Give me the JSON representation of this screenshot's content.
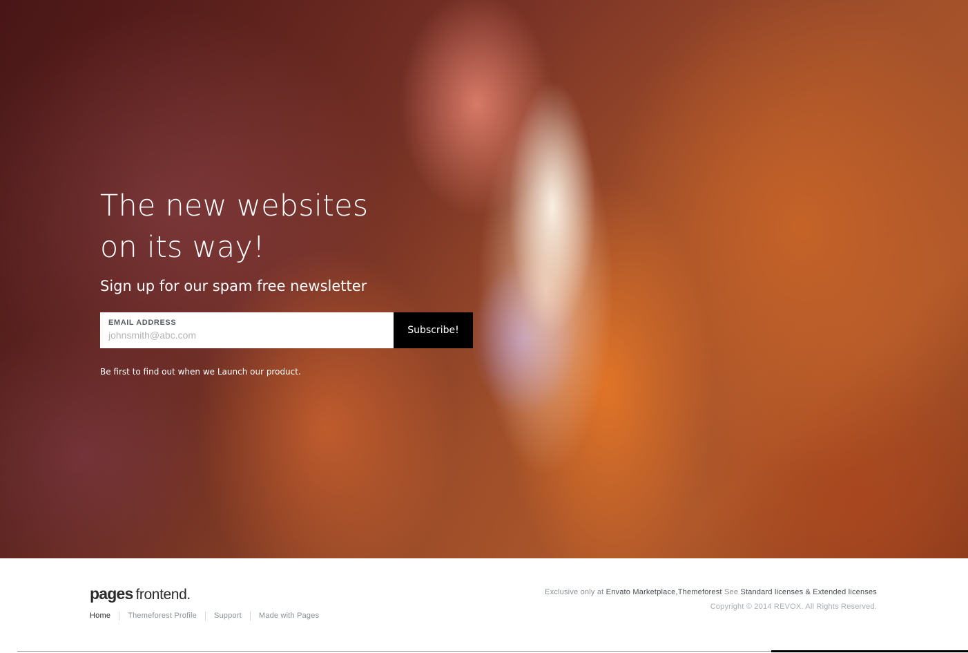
{
  "hero": {
    "headline_line1": "The new websites",
    "headline_line2": "on its way!",
    "subheadline": "Sign up for our spam free newsletter",
    "email_label": "EMAIL ADDRESS",
    "email_placeholder": "johnsmith@abc.com",
    "email_value": "",
    "subscribe_label": "Subscribe!",
    "tagline": "Be first to find out when we Launch our product."
  },
  "footer": {
    "logo_bold": "pages",
    "logo_light": "frontend.",
    "nav": [
      {
        "label": "Home"
      },
      {
        "label": "Themeforest Profile"
      },
      {
        "label": "Support"
      },
      {
        "label": "Made with Pages"
      }
    ],
    "exclusive_prefix": "Exclusive only at",
    "exclusive_link": "Envato Marketplace,Themeforest",
    "see_word": "See",
    "licenses_link": "Standard licenses & Extended licenses",
    "copyright": "Copyright © 2014 REVOX. All Rights Reserved."
  },
  "colors": {
    "button_bg": "#000000",
    "hero_text": "#ffffff",
    "footer_text": "#8a8f94",
    "footer_dark_text": "#2c2c2c"
  }
}
